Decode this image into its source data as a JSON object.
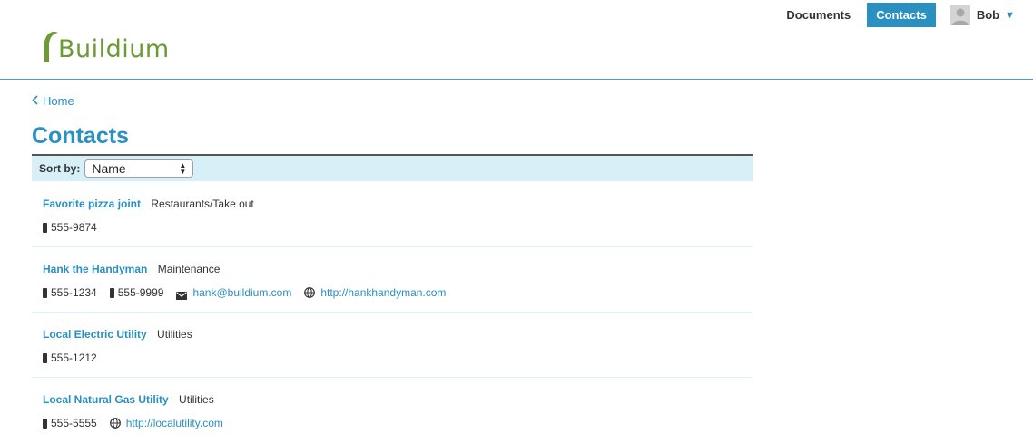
{
  "brand": {
    "logo_text": "Buildium",
    "logo_color": "#6b9b32"
  },
  "topnav": {
    "documents": "Documents",
    "contacts": "Contacts",
    "user_name": "Bob",
    "caret": "▼"
  },
  "breadcrumb": {
    "home": "Home"
  },
  "page_title": "Contacts",
  "sort": {
    "label": "Sort by:",
    "selected": "Name"
  },
  "contacts": [
    {
      "name": "Favorite pizza joint",
      "category": "Restaurants/Take out",
      "phones": [
        "555-9874"
      ]
    },
    {
      "name": "Hank the Handyman",
      "category": "Maintenance",
      "phones": [
        "555-1234",
        "555-9999"
      ],
      "email": "hank@buildium.com",
      "website": "http://hankhandyman.com"
    },
    {
      "name": "Local Electric Utility",
      "category": "Utilities",
      "phones": [
        "555-1212"
      ]
    },
    {
      "name": "Local Natural Gas Utility",
      "category": "Utilities",
      "phones": [
        "555-5555"
      ],
      "website": "http://localutility.com"
    }
  ],
  "colors": {
    "accent": "#2a8fc1",
    "sortbar_bg": "#d7eff7",
    "text": "#333333"
  }
}
